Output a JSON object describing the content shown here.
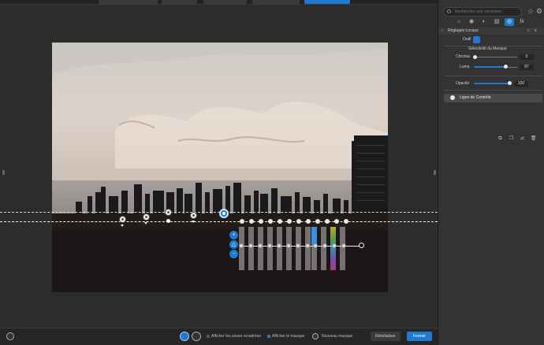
{
  "app": {
    "accent": "#1f7ad0"
  },
  "sidepanel": {
    "search_placeholder": "Rechercher une correction",
    "icons": {
      "favorite": "star-icon",
      "settings": "gear-icon"
    },
    "tabs": [
      {
        "icon": "sun-icon",
        "glyph": "☼"
      },
      {
        "icon": "palette-icon",
        "glyph": "◉"
      },
      {
        "icon": "detail-icon",
        "glyph": "◐"
      },
      {
        "icon": "layers-icon",
        "glyph": "▧"
      },
      {
        "icon": "local-adjustments-icon",
        "glyph": "◎",
        "active": true
      },
      {
        "icon": "fx-icon",
        "glyph": "fx"
      }
    ],
    "section_title": "Réglages Locaux",
    "tool_label": "Outil",
    "mask_selectivity_title": "Sélectivité du Masque",
    "chroma": {
      "label": "Chroma",
      "value": "0"
    },
    "luma": {
      "label": "Luma",
      "value": "87"
    },
    "opacity": {
      "label": "Opacité",
      "value": "100"
    },
    "control_line_label": "Ligne de Contrôle"
  },
  "bottombar": {
    "show_cropped_label": "Afficher les zones recadrées",
    "show_mask_label": "Afficher le masque",
    "new_mask_label": "Nouveau masque",
    "reset_label": "Réinitialiser",
    "close_label": "Fermer"
  },
  "canvas": {
    "control_points": 5,
    "control_line_bars": 12
  }
}
